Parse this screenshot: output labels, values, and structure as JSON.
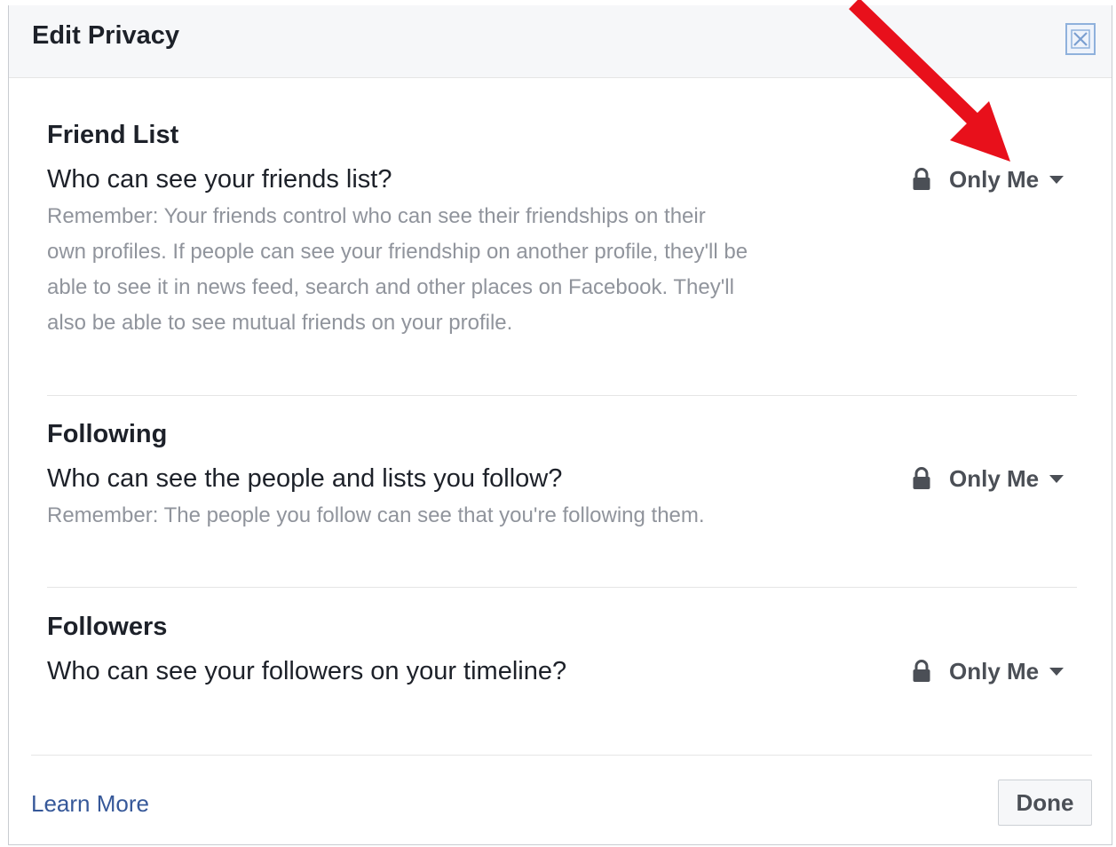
{
  "dialog": {
    "title": "Edit Privacy",
    "close_icon": "close-icon"
  },
  "sections": [
    {
      "title": "Friend List",
      "question": "Who can see your friends list?",
      "remember": "Remember: Your friends control who can see their friendships on their own profiles. If people can see your friendship on another profile, they'll be able to see it in news feed, search and other places on Facebook. They'll also be able to see mutual friends on your profile.",
      "audience": "Only Me"
    },
    {
      "title": "Following",
      "question": "Who can see the people and lists you follow?",
      "remember": "Remember: The people you follow can see that you're following them.",
      "audience": "Only Me"
    },
    {
      "title": "Followers",
      "question": "Who can see your followers on your timeline?",
      "audience": "Only Me"
    }
  ],
  "footer": {
    "learn_more": "Learn More",
    "done": "Done"
  },
  "icons": {
    "lock": "lock-icon",
    "caret": "caret-down-icon",
    "annotation": "red-arrow-icon"
  },
  "colors": {
    "title": "#1d2129",
    "muted": "#90949c",
    "link": "#365899",
    "arrow": "#e8101b"
  }
}
